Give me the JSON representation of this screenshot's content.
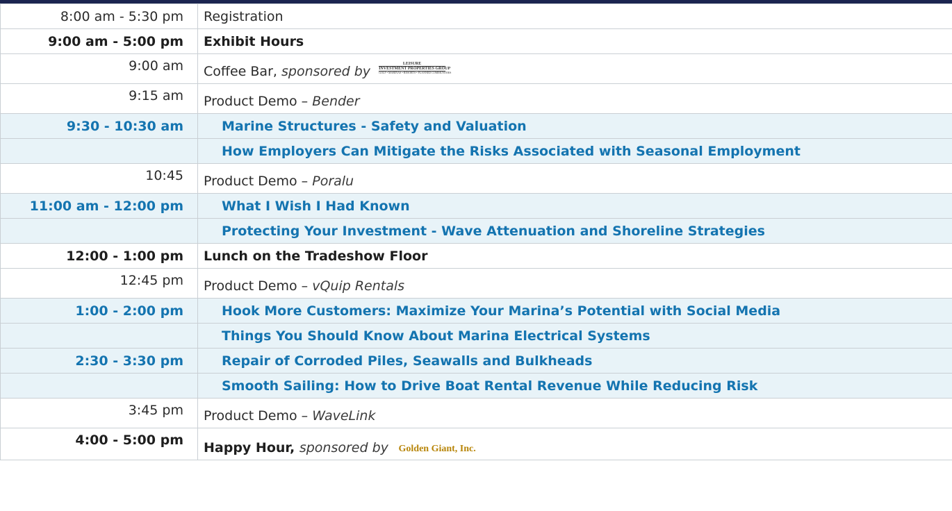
{
  "rows": [
    {
      "time": "8:00 am - 5:30 pm",
      "event": "Registration"
    },
    {
      "time": "9:00 am - 5:00 pm",
      "event": "Exhibit Hours"
    },
    {
      "time": "9:00 am",
      "event": "Coffee Bar,",
      "sub": "sponsored by",
      "logo_line1": "LEISURE",
      "logo_line2": "INVESTMENT PROPERTIES GROUP",
      "logo_line3": "GOLF • MARINAS • RESORTS • PLANNED COMMUNITIES"
    },
    {
      "time": "9:15 am",
      "event": "Product Demo –",
      "sub": "Bender"
    },
    {
      "time": "9:30 - 10:30 am",
      "event": "Marine Structures - Safety and Valuation"
    },
    {
      "time": "",
      "event": "How Employers Can Mitigate the Risks Associated with Seasonal Employment"
    },
    {
      "time": "10:45",
      "event": "Product Demo –",
      "sub": "Poralu"
    },
    {
      "time": "11:00 am - 12:00 pm",
      "event": "What I Wish I Had Known"
    },
    {
      "time": "",
      "event": "Protecting Your Investment - Wave Attenuation and Shoreline Strategies"
    },
    {
      "time": "12:00 - 1:00 pm",
      "event": "Lunch on the Tradeshow Floor"
    },
    {
      "time": "12:45 pm",
      "event": "Product Demo –",
      "sub": "vQuip Rentals"
    },
    {
      "time": "1:00 - 2:00 pm",
      "event": "Hook More Customers: Maximize Your Marina’s Potential with Social Media"
    },
    {
      "time": "",
      "event": "Things You Should Know About Marina Electrical Systems"
    },
    {
      "time": "2:30 - 3:30 pm",
      "event": "Repair of Corroded Piles, Seawalls and Bulkheads"
    },
    {
      "time": "",
      "event": "Smooth Sailing: How to Drive Boat Rental Revenue While Reducing Risk"
    },
    {
      "time": "3:45 pm",
      "event": "Product Demo –",
      "sub": "WaveLink"
    },
    {
      "time": "4:00 - 5:00 pm",
      "event": "Happy Hour,",
      "sub": "sponsored by",
      "logo": "Golden Giant, Inc."
    }
  ]
}
